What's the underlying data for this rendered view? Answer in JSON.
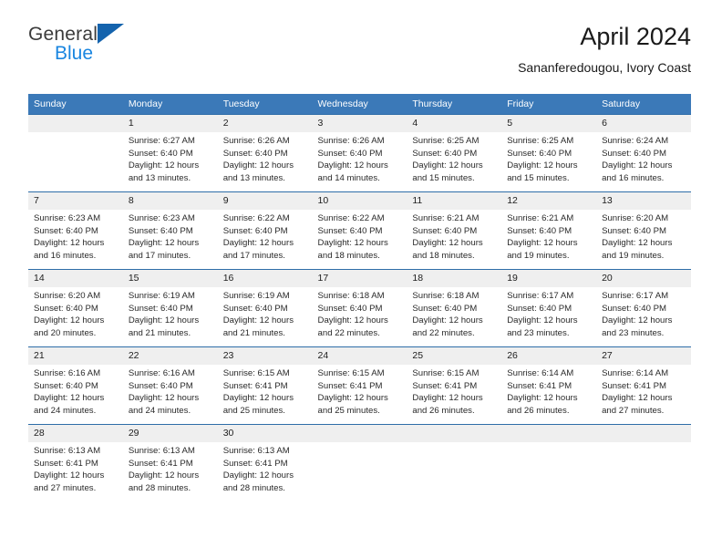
{
  "logo": {
    "word_top": "General",
    "word_bottom": "Blue",
    "triangle_icon": "triangle-icon",
    "brand_blue": "#1a86e0",
    "triangle_blue": "#1463ad"
  },
  "header": {
    "title": "April 2024",
    "subtitle": "Sananferedougou, Ivory Coast"
  },
  "colors": {
    "header_row_bg": "#3b79b8",
    "header_row_text": "#ffffff",
    "daynum_bg": "#efefef",
    "cell_border": "#2e6da8"
  },
  "weekdays": [
    "Sunday",
    "Monday",
    "Tuesday",
    "Wednesday",
    "Thursday",
    "Friday",
    "Saturday"
  ],
  "weeks": [
    [
      {
        "day": "",
        "sunrise": "",
        "sunset": "",
        "daylight_line1": "",
        "daylight_line2": ""
      },
      {
        "day": "1",
        "sunrise": "Sunrise: 6:27 AM",
        "sunset": "Sunset: 6:40 PM",
        "daylight_line1": "Daylight: 12 hours",
        "daylight_line2": "and 13 minutes."
      },
      {
        "day": "2",
        "sunrise": "Sunrise: 6:26 AM",
        "sunset": "Sunset: 6:40 PM",
        "daylight_line1": "Daylight: 12 hours",
        "daylight_line2": "and 13 minutes."
      },
      {
        "day": "3",
        "sunrise": "Sunrise: 6:26 AM",
        "sunset": "Sunset: 6:40 PM",
        "daylight_line1": "Daylight: 12 hours",
        "daylight_line2": "and 14 minutes."
      },
      {
        "day": "4",
        "sunrise": "Sunrise: 6:25 AM",
        "sunset": "Sunset: 6:40 PM",
        "daylight_line1": "Daylight: 12 hours",
        "daylight_line2": "and 15 minutes."
      },
      {
        "day": "5",
        "sunrise": "Sunrise: 6:25 AM",
        "sunset": "Sunset: 6:40 PM",
        "daylight_line1": "Daylight: 12 hours",
        "daylight_line2": "and 15 minutes."
      },
      {
        "day": "6",
        "sunrise": "Sunrise: 6:24 AM",
        "sunset": "Sunset: 6:40 PM",
        "daylight_line1": "Daylight: 12 hours",
        "daylight_line2": "and 16 minutes."
      }
    ],
    [
      {
        "day": "7",
        "sunrise": "Sunrise: 6:23 AM",
        "sunset": "Sunset: 6:40 PM",
        "daylight_line1": "Daylight: 12 hours",
        "daylight_line2": "and 16 minutes."
      },
      {
        "day": "8",
        "sunrise": "Sunrise: 6:23 AM",
        "sunset": "Sunset: 6:40 PM",
        "daylight_line1": "Daylight: 12 hours",
        "daylight_line2": "and 17 minutes."
      },
      {
        "day": "9",
        "sunrise": "Sunrise: 6:22 AM",
        "sunset": "Sunset: 6:40 PM",
        "daylight_line1": "Daylight: 12 hours",
        "daylight_line2": "and 17 minutes."
      },
      {
        "day": "10",
        "sunrise": "Sunrise: 6:22 AM",
        "sunset": "Sunset: 6:40 PM",
        "daylight_line1": "Daylight: 12 hours",
        "daylight_line2": "and 18 minutes."
      },
      {
        "day": "11",
        "sunrise": "Sunrise: 6:21 AM",
        "sunset": "Sunset: 6:40 PM",
        "daylight_line1": "Daylight: 12 hours",
        "daylight_line2": "and 18 minutes."
      },
      {
        "day": "12",
        "sunrise": "Sunrise: 6:21 AM",
        "sunset": "Sunset: 6:40 PM",
        "daylight_line1": "Daylight: 12 hours",
        "daylight_line2": "and 19 minutes."
      },
      {
        "day": "13",
        "sunrise": "Sunrise: 6:20 AM",
        "sunset": "Sunset: 6:40 PM",
        "daylight_line1": "Daylight: 12 hours",
        "daylight_line2": "and 19 minutes."
      }
    ],
    [
      {
        "day": "14",
        "sunrise": "Sunrise: 6:20 AM",
        "sunset": "Sunset: 6:40 PM",
        "daylight_line1": "Daylight: 12 hours",
        "daylight_line2": "and 20 minutes."
      },
      {
        "day": "15",
        "sunrise": "Sunrise: 6:19 AM",
        "sunset": "Sunset: 6:40 PM",
        "daylight_line1": "Daylight: 12 hours",
        "daylight_line2": "and 21 minutes."
      },
      {
        "day": "16",
        "sunrise": "Sunrise: 6:19 AM",
        "sunset": "Sunset: 6:40 PM",
        "daylight_line1": "Daylight: 12 hours",
        "daylight_line2": "and 21 minutes."
      },
      {
        "day": "17",
        "sunrise": "Sunrise: 6:18 AM",
        "sunset": "Sunset: 6:40 PM",
        "daylight_line1": "Daylight: 12 hours",
        "daylight_line2": "and 22 minutes."
      },
      {
        "day": "18",
        "sunrise": "Sunrise: 6:18 AM",
        "sunset": "Sunset: 6:40 PM",
        "daylight_line1": "Daylight: 12 hours",
        "daylight_line2": "and 22 minutes."
      },
      {
        "day": "19",
        "sunrise": "Sunrise: 6:17 AM",
        "sunset": "Sunset: 6:40 PM",
        "daylight_line1": "Daylight: 12 hours",
        "daylight_line2": "and 23 minutes."
      },
      {
        "day": "20",
        "sunrise": "Sunrise: 6:17 AM",
        "sunset": "Sunset: 6:40 PM",
        "daylight_line1": "Daylight: 12 hours",
        "daylight_line2": "and 23 minutes."
      }
    ],
    [
      {
        "day": "21",
        "sunrise": "Sunrise: 6:16 AM",
        "sunset": "Sunset: 6:40 PM",
        "daylight_line1": "Daylight: 12 hours",
        "daylight_line2": "and 24 minutes."
      },
      {
        "day": "22",
        "sunrise": "Sunrise: 6:16 AM",
        "sunset": "Sunset: 6:40 PM",
        "daylight_line1": "Daylight: 12 hours",
        "daylight_line2": "and 24 minutes."
      },
      {
        "day": "23",
        "sunrise": "Sunrise: 6:15 AM",
        "sunset": "Sunset: 6:41 PM",
        "daylight_line1": "Daylight: 12 hours",
        "daylight_line2": "and 25 minutes."
      },
      {
        "day": "24",
        "sunrise": "Sunrise: 6:15 AM",
        "sunset": "Sunset: 6:41 PM",
        "daylight_line1": "Daylight: 12 hours",
        "daylight_line2": "and 25 minutes."
      },
      {
        "day": "25",
        "sunrise": "Sunrise: 6:15 AM",
        "sunset": "Sunset: 6:41 PM",
        "daylight_line1": "Daylight: 12 hours",
        "daylight_line2": "and 26 minutes."
      },
      {
        "day": "26",
        "sunrise": "Sunrise: 6:14 AM",
        "sunset": "Sunset: 6:41 PM",
        "daylight_line1": "Daylight: 12 hours",
        "daylight_line2": "and 26 minutes."
      },
      {
        "day": "27",
        "sunrise": "Sunrise: 6:14 AM",
        "sunset": "Sunset: 6:41 PM",
        "daylight_line1": "Daylight: 12 hours",
        "daylight_line2": "and 27 minutes."
      }
    ],
    [
      {
        "day": "28",
        "sunrise": "Sunrise: 6:13 AM",
        "sunset": "Sunset: 6:41 PM",
        "daylight_line1": "Daylight: 12 hours",
        "daylight_line2": "and 27 minutes."
      },
      {
        "day": "29",
        "sunrise": "Sunrise: 6:13 AM",
        "sunset": "Sunset: 6:41 PM",
        "daylight_line1": "Daylight: 12 hours",
        "daylight_line2": "and 28 minutes."
      },
      {
        "day": "30",
        "sunrise": "Sunrise: 6:13 AM",
        "sunset": "Sunset: 6:41 PM",
        "daylight_line1": "Daylight: 12 hours",
        "daylight_line2": "and 28 minutes."
      },
      {
        "day": "",
        "sunrise": "",
        "sunset": "",
        "daylight_line1": "",
        "daylight_line2": ""
      },
      {
        "day": "",
        "sunrise": "",
        "sunset": "",
        "daylight_line1": "",
        "daylight_line2": ""
      },
      {
        "day": "",
        "sunrise": "",
        "sunset": "",
        "daylight_line1": "",
        "daylight_line2": ""
      },
      {
        "day": "",
        "sunrise": "",
        "sunset": "",
        "daylight_line1": "",
        "daylight_line2": ""
      }
    ]
  ]
}
